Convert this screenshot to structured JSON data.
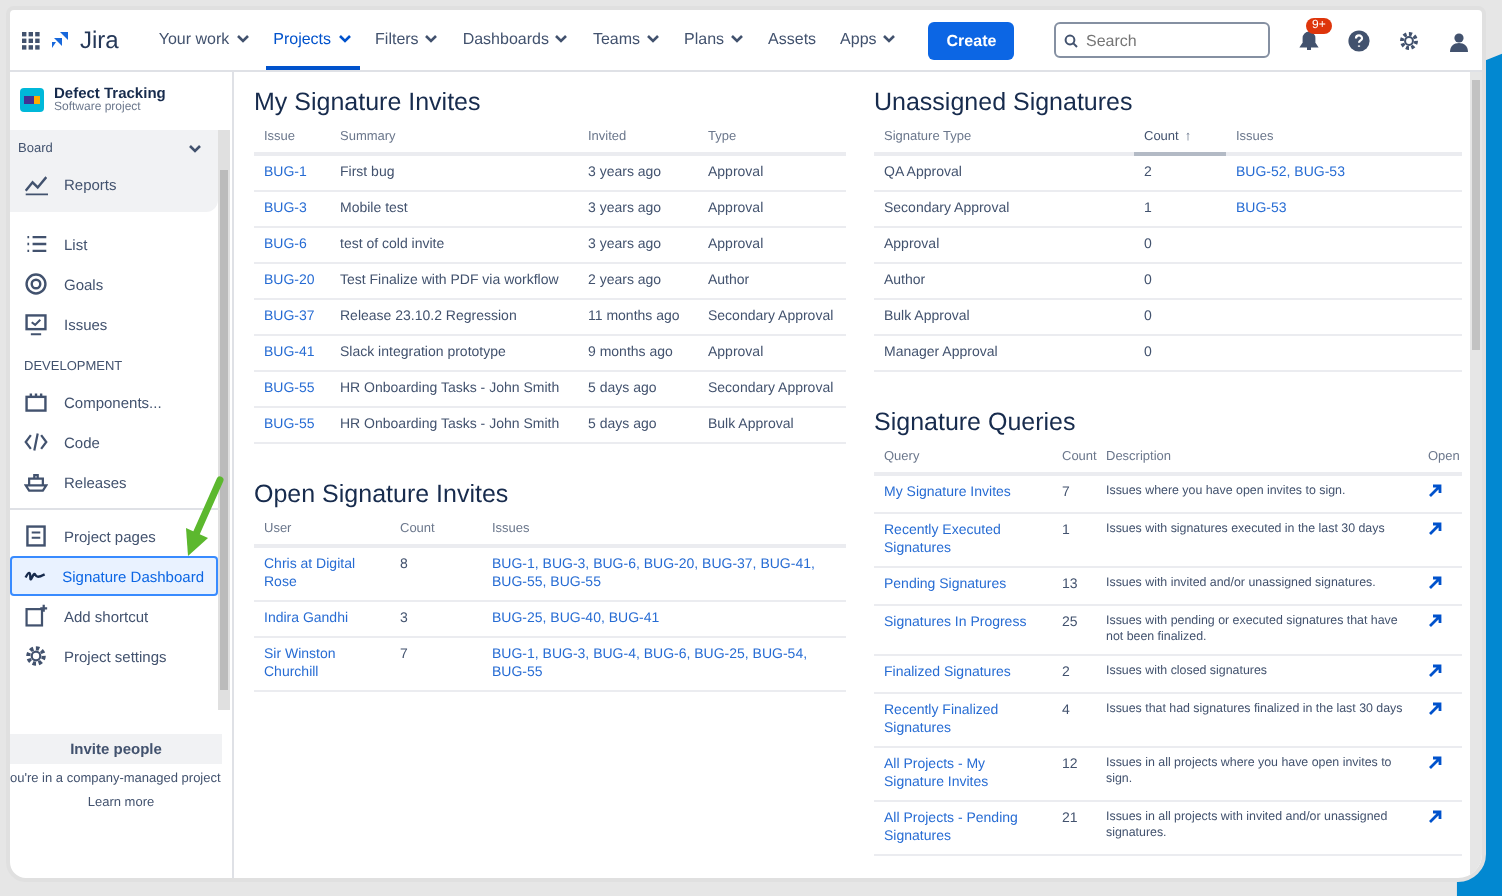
{
  "topbar": {
    "logo": "Jira",
    "nav": [
      {
        "label": "Your work",
        "menu": true,
        "selected": false
      },
      {
        "label": "Projects",
        "menu": true,
        "selected": true
      },
      {
        "label": "Filters",
        "menu": true,
        "selected": false
      },
      {
        "label": "Dashboards",
        "menu": true,
        "selected": false
      },
      {
        "label": "Teams",
        "menu": true,
        "selected": false
      },
      {
        "label": "Plans",
        "menu": true,
        "selected": false
      },
      {
        "label": "Assets",
        "menu": false,
        "selected": false
      },
      {
        "label": "Apps",
        "menu": true,
        "selected": false
      }
    ],
    "create_button": "Create",
    "search": {
      "placeholder": "Search"
    },
    "notification_badge": "9+"
  },
  "sidebar": {
    "project": {
      "name": "Defect Tracking",
      "type": "Software project"
    },
    "group": {
      "label": "Board",
      "expanded": true,
      "items": [
        {
          "label": "Reports",
          "selected": false
        }
      ]
    },
    "items": [
      {
        "label": "List",
        "selected": false
      },
      {
        "label": "Goals",
        "selected": false
      },
      {
        "label": "Issues",
        "selected": false
      }
    ],
    "section": "DEVELOPMENT",
    "dev_items": [
      {
        "label": "Components...",
        "selected": false
      },
      {
        "label": "Code",
        "selected": false
      },
      {
        "label": "Releases",
        "selected": false
      }
    ],
    "bottom_items": [
      {
        "label": "Project pages",
        "selected": false
      },
      {
        "label": "Signature Dashboard",
        "selected": true
      },
      {
        "label": "Add shortcut",
        "selected": false
      },
      {
        "label": "Project settings",
        "selected": false
      }
    ],
    "invite_button": "Invite people",
    "note": "ou're in a company-managed project",
    "learn_more": "Learn more"
  },
  "my_signature_invites": {
    "title": "My Signature Invites",
    "columns": [
      {
        "label": "Issue",
        "kind": "link"
      },
      {
        "label": "Summary",
        "kind": "text"
      },
      {
        "label": "Invited",
        "kind": "text"
      },
      {
        "label": "Type",
        "kind": "text"
      }
    ],
    "rows": [
      [
        "BUG-1",
        "First bug",
        "3 years ago",
        "Approval"
      ],
      [
        "BUG-3",
        "Mobile test",
        "3 years ago",
        "Approval"
      ],
      [
        "BUG-6",
        "test of cold invite",
        "3 years ago",
        "Approval"
      ],
      [
        "BUG-20",
        "Test Finalize with PDF via workflow",
        "2 years ago",
        "Author"
      ],
      [
        "BUG-37",
        "Release 23.10.2 Regression",
        "11 months ago",
        "Secondary Approval"
      ],
      [
        "BUG-41",
        "Slack integration prototype",
        "9 months ago",
        "Approval"
      ],
      [
        "BUG-55",
        "HR Onboarding Tasks - John Smith",
        "5 days ago",
        "Secondary Approval"
      ],
      [
        "BUG-55",
        "HR Onboarding Tasks - John Smith",
        "5 days ago",
        "Bulk Approval"
      ]
    ]
  },
  "open_signature_invites": {
    "title": "Open Signature Invites",
    "columns": [
      {
        "label": "User",
        "kind": "link"
      },
      {
        "label": "Count",
        "kind": "text"
      },
      {
        "label": "Issues",
        "kind": "link"
      }
    ],
    "rows": [
      [
        "Chris at Digital Rose",
        "8",
        "BUG-1, BUG-3, BUG-6, BUG-20, BUG-37, BUG-41, BUG-55, BUG-55"
      ],
      [
        "Indira Gandhi",
        "3",
        "BUG-25, BUG-40, BUG-41"
      ],
      [
        "Sir Winston Churchill",
        "7",
        "BUG-1, BUG-3, BUG-4, BUG-6, BUG-25, BUG-54, BUG-55"
      ]
    ]
  },
  "unassigned_signatures": {
    "title": "Unassigned Signatures",
    "columns": [
      {
        "label": "Signature Type",
        "kind": "text",
        "sorted": false
      },
      {
        "label": "Count",
        "kind": "text",
        "sorted": true
      },
      {
        "label": "Issues",
        "kind": "link",
        "sorted": false
      }
    ],
    "sort_icon": "↑",
    "rows": [
      [
        "QA Approval",
        "2",
        "BUG-52, BUG-53"
      ],
      [
        "Secondary Approval",
        "1",
        "BUG-53"
      ],
      [
        "Approval",
        "0",
        ""
      ],
      [
        "Author",
        "0",
        ""
      ],
      [
        "Bulk Approval",
        "0",
        ""
      ],
      [
        "Manager Approval",
        "0",
        ""
      ]
    ]
  },
  "signature_queries": {
    "title": "Signature Queries",
    "columns": [
      {
        "label": "Query",
        "kind": "link"
      },
      {
        "label": "Count",
        "kind": "text"
      },
      {
        "label": "Description",
        "kind": "small"
      },
      {
        "label": "Open",
        "kind": "icon"
      }
    ],
    "rows": [
      [
        "My Signature Invites",
        "7",
        "Issues where you have open invites to sign."
      ],
      [
        "Recently Executed Signatures",
        "1",
        "Issues with signatures executed in the last 30 days"
      ],
      [
        "Pending Signatures",
        "13",
        "Issues with invited and/or unassigned signatures."
      ],
      [
        "Signatures In Progress",
        "25",
        "Issues with pending or executed signatures that have not been finalized."
      ],
      [
        "Finalized Signatures",
        "2",
        "Issues with closed signatures"
      ],
      [
        "Recently Finalized Signatures",
        "4",
        "Issues that had signatures finalized in the last 30 days"
      ],
      [
        "All Projects - My Signature Invites",
        "12",
        "Issues in all projects where you have open invites to sign."
      ],
      [
        "All Projects - Pending Signatures",
        "21",
        "Issues in all projects with invited and/or unassigned signatures."
      ]
    ]
  }
}
